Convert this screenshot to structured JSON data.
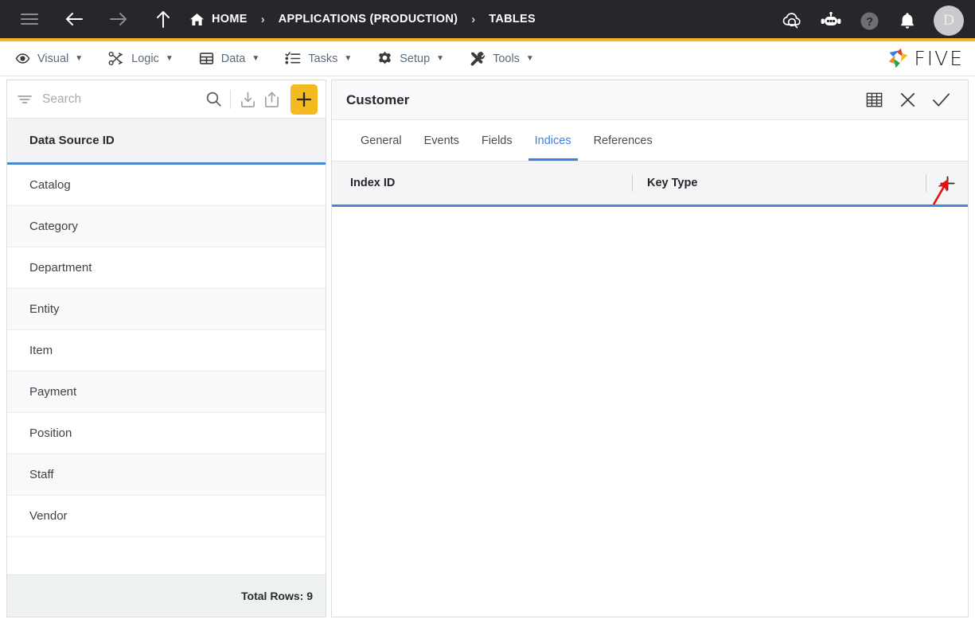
{
  "topbar": {
    "menu_icon": "hamburger-icon",
    "back_icon": "arrow-left-icon",
    "forward_icon": "arrow-right-icon",
    "up_icon": "arrow-up-icon",
    "breadcrumbs": [
      {
        "label": "HOME",
        "icon": "home-icon"
      },
      {
        "label": "APPLICATIONS (PRODUCTION)",
        "icon": ""
      },
      {
        "label": "TABLES",
        "icon": ""
      }
    ],
    "separator": "›",
    "right_icons": [
      {
        "name": "cloud-check-icon"
      },
      {
        "name": "chat-bot-icon"
      },
      {
        "name": "help-circle-icon"
      },
      {
        "name": "bell-icon"
      }
    ],
    "avatar_initial": "D",
    "accent_color": "#f4b323",
    "background_color": "#26272b"
  },
  "menubar": {
    "items": [
      {
        "label": "Visual",
        "icon": "eye-icon",
        "caret": "▼"
      },
      {
        "label": "Logic",
        "icon": "nodes-icon",
        "caret": "▼"
      },
      {
        "label": "Data",
        "icon": "grid-icon",
        "caret": "▼"
      },
      {
        "label": "Tasks",
        "icon": "checklist-icon",
        "caret": "▼"
      },
      {
        "label": "Setup",
        "icon": "gear-icon",
        "caret": "▼"
      },
      {
        "label": "Tools",
        "icon": "tools-icon",
        "caret": "▼"
      }
    ],
    "brand": {
      "text": "FIVE",
      "mark": "five-pinwheel-logo"
    }
  },
  "left_panel": {
    "search": {
      "placeholder": "Search",
      "value": "",
      "filter_icon": "filter-icon",
      "search_icon": "search-icon",
      "import_icon": "import-icon",
      "export_icon": "export-icon",
      "add_icon": "plus-icon"
    },
    "column_header": "Data Source ID",
    "rows": [
      {
        "label": "Catalog"
      },
      {
        "label": "Category"
      },
      {
        "label": "Department"
      },
      {
        "label": "Entity"
      },
      {
        "label": "Item"
      },
      {
        "label": "Payment"
      },
      {
        "label": "Position"
      },
      {
        "label": "Staff"
      },
      {
        "label": "Vendor"
      }
    ],
    "footer": "Total Rows: 9"
  },
  "right_panel": {
    "title": "Customer",
    "header_icons": [
      {
        "name": "table-view-icon"
      },
      {
        "name": "close-icon"
      },
      {
        "name": "confirm-check-icon"
      }
    ],
    "tabs": [
      {
        "label": "General",
        "active": false
      },
      {
        "label": "Events",
        "active": false
      },
      {
        "label": "Fields",
        "active": false
      },
      {
        "label": "Indices",
        "active": true
      },
      {
        "label": "References",
        "active": false
      }
    ],
    "table": {
      "columns": [
        "Index ID",
        "Key Type"
      ],
      "add_icon": "plus-icon",
      "rows": []
    }
  },
  "annotation": {
    "arrow": "red-arrow-pointing-to-add-index-button",
    "color": "#e8100f"
  }
}
